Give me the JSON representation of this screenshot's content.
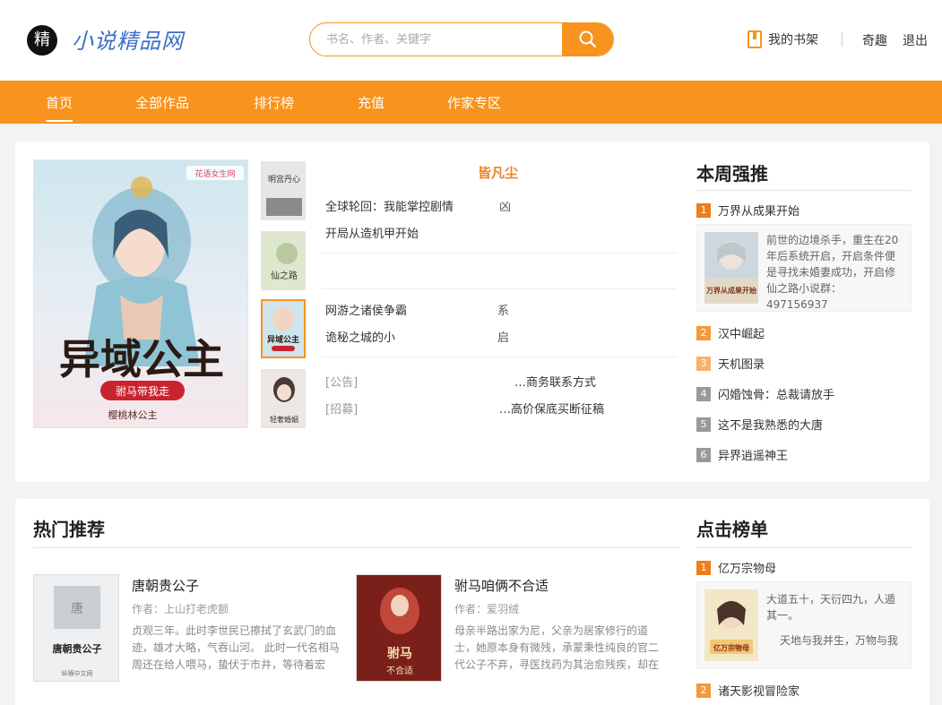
{
  "header": {
    "logo_badge": "精",
    "site_name": "小说精品网",
    "search": {
      "placeholder": "书名、作者、关键字"
    },
    "shelf_label": "我的书架",
    "user_name": "奇趣",
    "logout_label": "退出"
  },
  "nav": {
    "items": [
      {
        "label": "首页",
        "active": true
      },
      {
        "label": "全部作品"
      },
      {
        "label": "排行榜"
      },
      {
        "label": "充值"
      },
      {
        "label": "作家专区"
      }
    ]
  },
  "featured": {
    "cover_title": "异域公主",
    "cover_sub": "驸马带我走",
    "cover_author": "樱桃林公主",
    "cover_badge": "花语女生网",
    "thumb_titles": [
      "明宫丹心",
      "仙之路",
      "异域公主",
      "轻奢婚姻"
    ],
    "center_title": "皆凡尘",
    "group1": [
      {
        "title": "全球轮回：我能掌控剧情",
        "extra": "凶"
      },
      {
        "title": "开局从造机甲开始",
        "extra": ""
      }
    ],
    "group2": [
      {
        "title": "网游之诸侯争霸",
        "extra": "系"
      },
      {
        "title": "诡秘之城的小",
        "extra": "启"
      }
    ],
    "notices": [
      {
        "tag": "[公告]",
        "text": "…商务联系方式"
      },
      {
        "tag": "[招募]",
        "text": "…高价保底买断征稿"
      }
    ]
  },
  "weekly": {
    "title": "本周强推",
    "items": [
      {
        "rank": "1",
        "title": "万界从成果开始",
        "desc": "前世的边境杀手，重生在20年后系统开启，开启条件便是寻找未婚妻成功，开启修仙之路小说群：497156937",
        "cover_text": "万界从成果开始"
      },
      {
        "rank": "2",
        "title": "汉中崛起"
      },
      {
        "rank": "3",
        "title": "天机图录"
      },
      {
        "rank": "4",
        "title": "闪婚蚀骨：总裁请放手"
      },
      {
        "rank": "5",
        "title": "这不是我熟悉的大唐"
      },
      {
        "rank": "6",
        "title": "异界逍遥神王"
      }
    ]
  },
  "hot": {
    "title": "热门推荐",
    "books": [
      {
        "name": "唐朝贵公子",
        "author": "作者：上山打老虎额",
        "desc": "贞观三年。此时李世民已擦拭了玄武门的血迹，雄才大略，气吞山河。 此时一代名相马周还在给人喂马，蛰伏于市井，等待着宏",
        "cover_title": "唐朝贵公子",
        "cover_pub": "纵横中文网"
      },
      {
        "name": "驸马咱俩不合适",
        "author": "作者：爱羽绒",
        "desc": "母亲半路出家为尼，父亲为居家修行的道士，她原本身有微残，承蒙秉性纯良的官二代公子不弃，寻医找药为其治愈残疾，却在",
        "cover_title": "驸马咱俩不合适"
      }
    ]
  },
  "clicks": {
    "title": "点击榜单",
    "items": [
      {
        "rank": "1",
        "title": "亿万宗物母",
        "desc1": "大道五十，天衍四九，人遁其一。",
        "desc2": "天地与我并生，万物与我",
        "cover_text": "亿万宗物母"
      },
      {
        "rank": "2",
        "title": "诸天影视冒险家"
      }
    ]
  },
  "colors": {
    "accent": "#f7931e",
    "brand_blue": "#3b6fc5"
  }
}
